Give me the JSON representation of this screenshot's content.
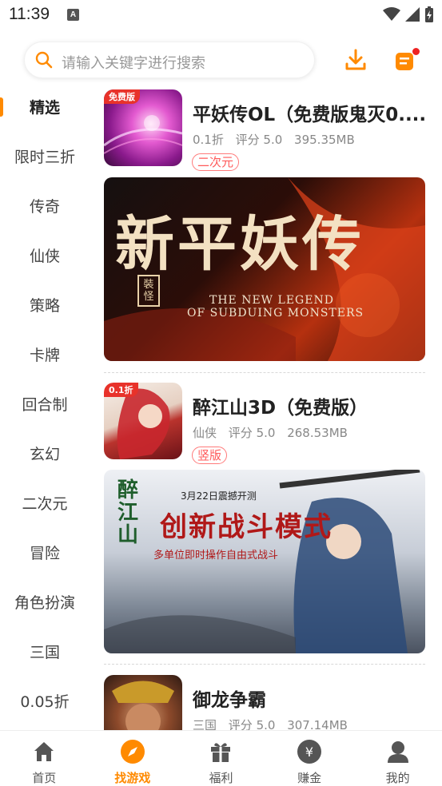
{
  "status": {
    "time": "11:39",
    "notify_glyph": "A"
  },
  "search": {
    "placeholder": "请输入关键字进行搜索"
  },
  "sidebar": {
    "items": [
      {
        "label": "精选",
        "active": true
      },
      {
        "label": "限时三折"
      },
      {
        "label": "传奇"
      },
      {
        "label": "仙侠"
      },
      {
        "label": "策略"
      },
      {
        "label": "卡牌"
      },
      {
        "label": "回合制"
      },
      {
        "label": "玄幻"
      },
      {
        "label": "二次元"
      },
      {
        "label": "冒险"
      },
      {
        "label": "角色扮演"
      },
      {
        "label": "三国"
      },
      {
        "label": "0.05折"
      }
    ]
  },
  "games": [
    {
      "title": "平妖传OL（免费版鬼灭0....",
      "discount": "0.1折",
      "score": "评分 5.0",
      "size": "395.35MB",
      "tag": "二次元",
      "badge": "免费版",
      "banner": {
        "cn_title": "新平妖传",
        "seal": "裝怪",
        "en_line1": "THE NEW LEGEND",
        "en_line2": "OF SUBDUING MONSTERS"
      }
    },
    {
      "title": "醉江山3D（免费版）",
      "discount": "仙侠",
      "score": "评分 5.0",
      "size": "268.53MB",
      "tag": "竖版",
      "badge": "0.1折",
      "banner": {
        "logo": "醉江山",
        "date": "3月22日震撼开测",
        "headline": "创新战斗模式",
        "sub": "多单位即时操作自由式战斗"
      }
    },
    {
      "title": "御龙争霸",
      "discount": "三国",
      "score": "评分 5.0",
      "size": "307.14MB"
    }
  ],
  "bottom_nav": [
    {
      "label": "首页",
      "icon": "home-icon"
    },
    {
      "label": "找游戏",
      "icon": "compass-icon",
      "active": true
    },
    {
      "label": "福利",
      "icon": "gift-icon"
    },
    {
      "label": "赚金",
      "icon": "coin-icon"
    },
    {
      "label": "我的",
      "icon": "user-icon"
    }
  ],
  "colors": {
    "accent": "#ff8a00",
    "tag_red": "#ff5a5a",
    "dot_red": "#ee2222"
  }
}
